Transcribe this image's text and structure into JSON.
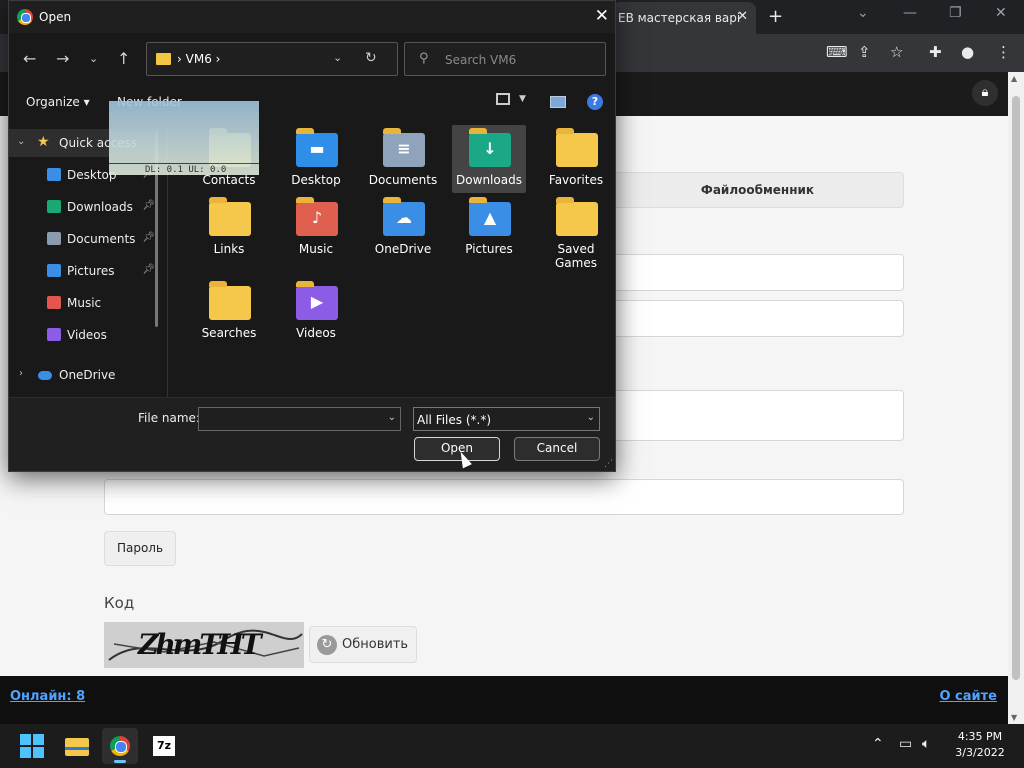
{
  "browser": {
    "tab_title": "ЕВ мастерская варі",
    "tab_close": "✕",
    "new_tab": "+",
    "content_tab": "Файлообменник",
    "password_button": "Пароль",
    "code_label": "Код",
    "captcha_text": "ZhmTHT",
    "refresh_button": "Обновить",
    "footer_online": "Онлайн: 8",
    "footer_about": "О сайте"
  },
  "dialog": {
    "title": "Open",
    "address_folder": "VM6",
    "search_placeholder": "Search VM6",
    "organize": "Organize ▾",
    "new_folder": "New folder",
    "thumb_overlay_text": "DL: 0.1 UL: 0.0",
    "nav": {
      "quick_access": "Quick access",
      "items": [
        {
          "label": "Desktop",
          "pinned": true,
          "color": "#3a8ee6"
        },
        {
          "label": "Downloads",
          "pinned": true,
          "color": "#19a974"
        },
        {
          "label": "Documents",
          "pinned": true,
          "color": "#8a9bb0"
        },
        {
          "label": "Pictures",
          "pinned": true,
          "color": "#3a8ee6"
        },
        {
          "label": "Music",
          "pinned": false,
          "color": "#e2564d"
        },
        {
          "label": "Videos",
          "pinned": false,
          "color": "#8d5ce6"
        }
      ],
      "onedrive": "OneDrive"
    },
    "files": [
      {
        "label": "Contacts",
        "icon": "folder"
      },
      {
        "label": "Desktop",
        "icon": "desktop"
      },
      {
        "label": "Documents",
        "icon": "documents"
      },
      {
        "label": "Downloads",
        "icon": "downloads",
        "selected": true
      },
      {
        "label": "Favorites",
        "icon": "folder"
      },
      {
        "label": "Links",
        "icon": "folder"
      },
      {
        "label": "Music",
        "icon": "music"
      },
      {
        "label": "OneDrive",
        "icon": "onedrive"
      },
      {
        "label": "Pictures",
        "icon": "pictures"
      },
      {
        "label": "Saved Games",
        "icon": "folder"
      },
      {
        "label": "Searches",
        "icon": "folder"
      },
      {
        "label": "Videos",
        "icon": "videos"
      }
    ],
    "file_name_label": "File name:",
    "file_name_value": "",
    "file_type": "All Files (*.*)",
    "open_button": "Open",
    "cancel_button": "Cancel"
  },
  "taskbar": {
    "time": "4:35 PM",
    "date": "3/3/2022",
    "seven_zip": "7z"
  },
  "colors": {
    "accent": "#4da3ff",
    "folder": "#f5c84c",
    "selected_item": "#444444"
  }
}
